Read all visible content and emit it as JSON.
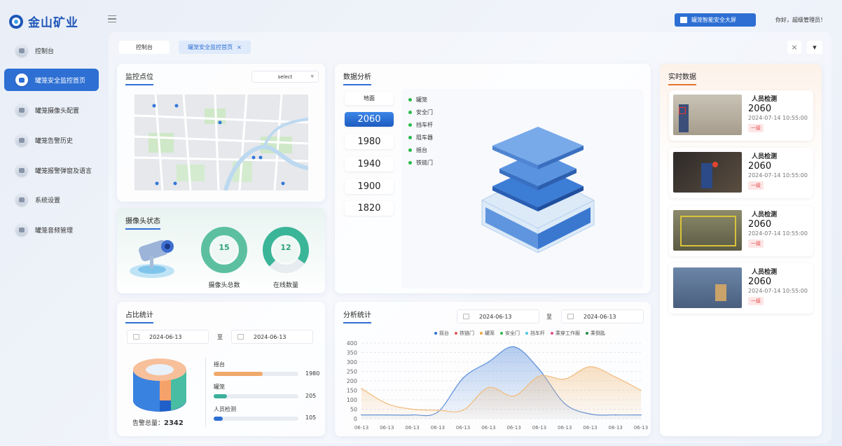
{
  "app": {
    "name": "金山矿业"
  },
  "header": {
    "big_screen_label": "罐笼智能安全大屏",
    "greeting": "你好，超级管理员！"
  },
  "sidebar": {
    "items": [
      {
        "label": "控制台"
      },
      {
        "label": "罐笼安全监控首页"
      },
      {
        "label": "罐笼摄像头配置"
      },
      {
        "label": "罐笼告警历史"
      },
      {
        "label": "罐笼报警弹窗及语言"
      },
      {
        "label": "系统设置"
      },
      {
        "label": "罐笼音频管理"
      }
    ]
  },
  "tabs": [
    {
      "label": "控制台"
    },
    {
      "label": "罐笼安全监控首页",
      "close": "×"
    }
  ],
  "tabbar": {
    "close": "×",
    "menu": "▼"
  },
  "monitor": {
    "title": "监控点位",
    "select_value": "select"
  },
  "camera_status": {
    "title": "摄像头状态",
    "total_value": "15",
    "total_label": "摄像头总数",
    "online_value": "12",
    "online_label": "在线数量",
    "online_ratio": 0.8
  },
  "analysis": {
    "title": "数据分析",
    "levels": [
      "地面",
      "2060",
      "1980",
      "1940",
      "1900",
      "1820"
    ],
    "selected": "2060",
    "legend": [
      "罐笼",
      "安全门",
      "挡车杆",
      "阻车器",
      "摇台",
      "铁链门"
    ]
  },
  "realtime": {
    "title": "实时数据",
    "cards": [
      {
        "title": "人员检测",
        "level": "2060",
        "time": "2024-07-14  10:55:00",
        "badge": "一级"
      },
      {
        "title": "人员检测",
        "level": "2060",
        "time": "2024-07-14  10:55:00",
        "badge": "一级"
      },
      {
        "title": "人员检测",
        "level": "2060",
        "time": "2024-07-14  10:55:00",
        "badge": "一级"
      },
      {
        "title": "人员检测",
        "level": "2060",
        "time": "2024-07-14  10:55:00",
        "badge": "一级"
      }
    ]
  },
  "ratio": {
    "title": "占比统计",
    "date_from": "2024-06-13",
    "date_to": "2024-06-13",
    "sep": "至",
    "total_label": "告警总量：",
    "total_value": "2342",
    "items": [
      {
        "label": "摇台",
        "value": "1980",
        "fraction": 0.58
      },
      {
        "label": "罐笼",
        "value": "205",
        "fraction": 0.16
      },
      {
        "label": "人员检测",
        "value": "105",
        "fraction": 0.11
      }
    ]
  },
  "trend": {
    "title": "分析统计",
    "date_from": "2024-06-13",
    "date_to": "2024-06-13",
    "sep": "至",
    "legend": [
      "摇台",
      "铁链门",
      "罐笼",
      "安全门",
      "挡车杆",
      "乘穿工作服",
      "乘倒匙"
    ]
  },
  "chart_data": {
    "type": "area",
    "x": [
      "06-13",
      "06-13",
      "06-13",
      "06-13",
      "06-13",
      "06-13",
      "06-13",
      "06-13",
      "06-13",
      "06-13",
      "06-13",
      "06-13"
    ],
    "ylim": [
      0,
      400
    ],
    "yticks": [
      0,
      50,
      100,
      150,
      200,
      250,
      300,
      350,
      400
    ],
    "series": [
      {
        "name": "摇台",
        "color": "#5a8fdc",
        "values": [
          20,
          20,
          20,
          35,
          215,
          300,
          380,
          260,
          80,
          25,
          20,
          20
        ]
      },
      {
        "name": "罐笼",
        "color": "#f2bb7a",
        "values": [
          160,
          80,
          50,
          45,
          45,
          165,
          120,
          225,
          210,
          275,
          220,
          150
        ]
      }
    ],
    "legend_colors": [
      "#2f6fd6",
      "#e25555",
      "#f0a33c",
      "#2bb94a",
      "#4cc7e0",
      "#e0508f",
      "#2a8a4a"
    ]
  }
}
